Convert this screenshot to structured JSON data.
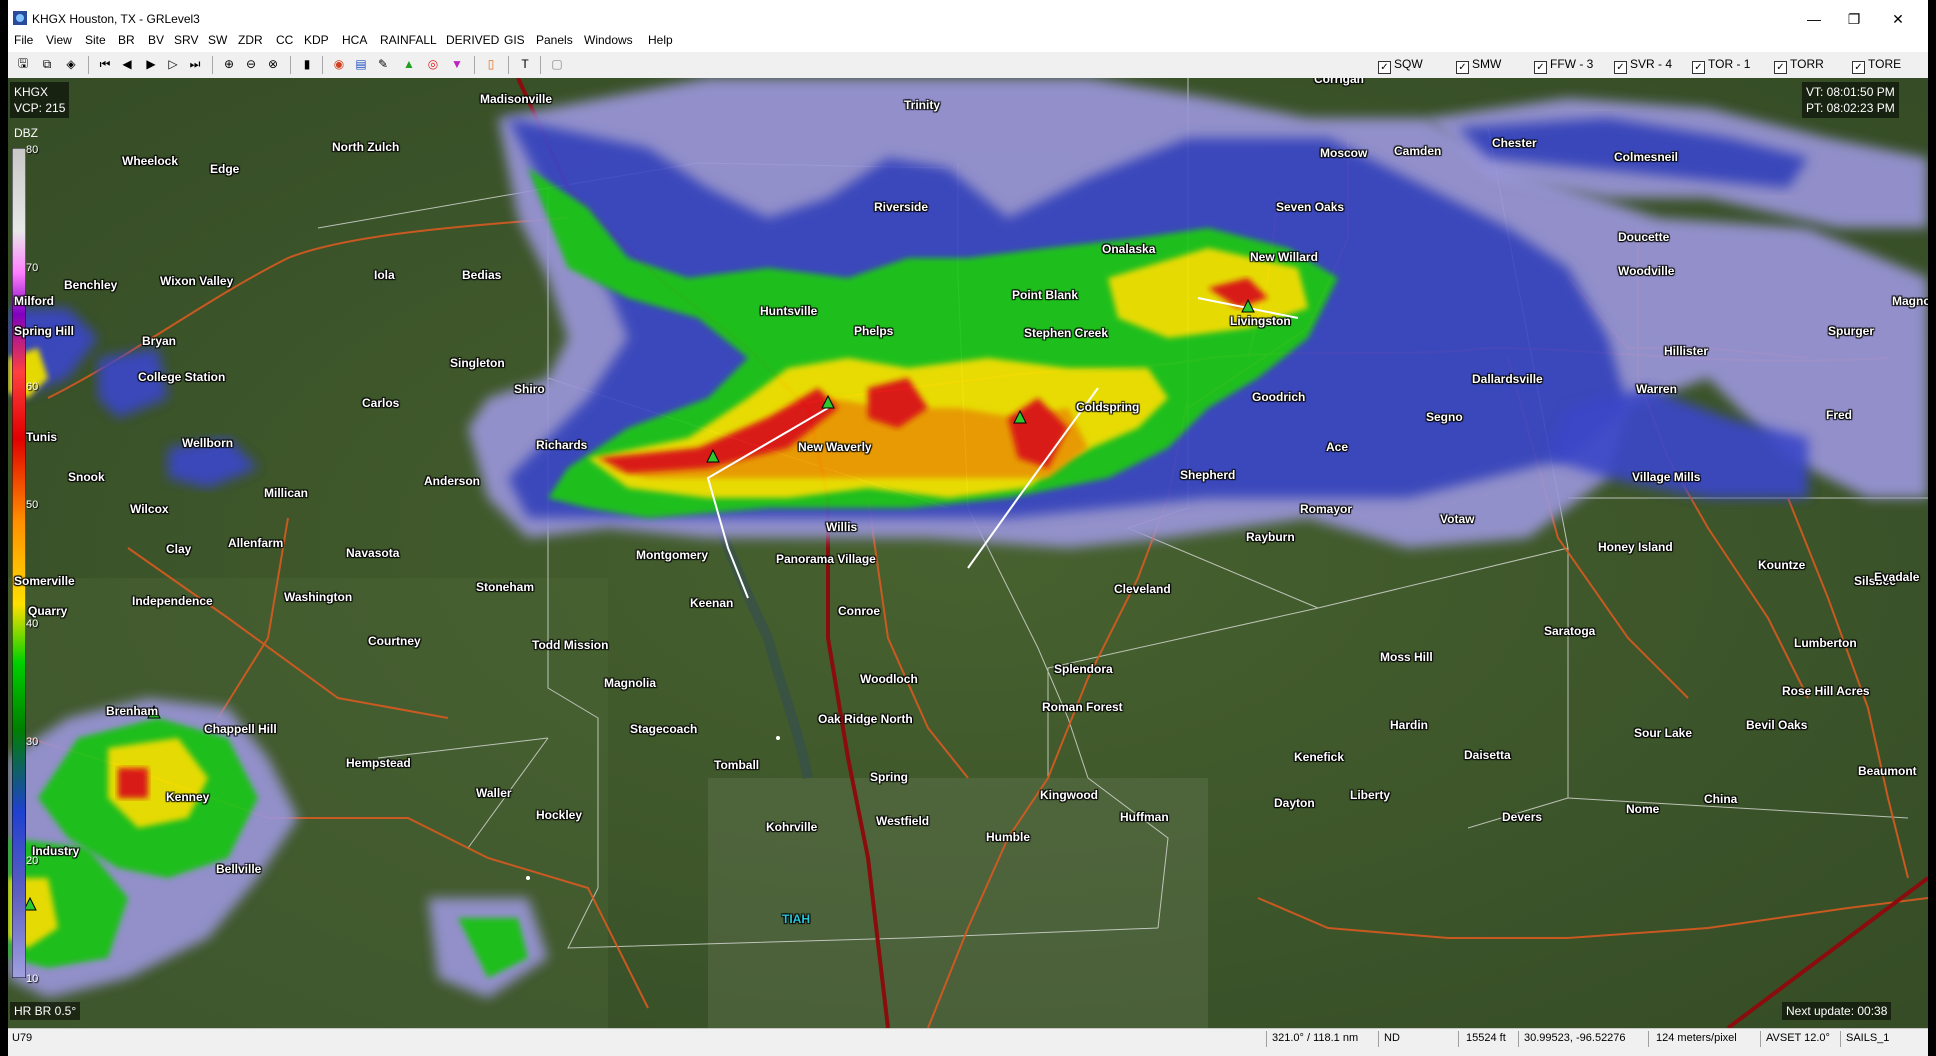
{
  "window": {
    "title": "KHGX Houston, TX - GRLevel3",
    "minimize": "—",
    "maximize": "❐",
    "close": "✕"
  },
  "menu": [
    "File",
    "View",
    "Site",
    "BR",
    "BV",
    "SRV",
    "SW",
    "ZDR",
    "CC",
    "KDP",
    "HCA",
    "RAINFALL",
    "DERIVED",
    "GIS",
    "Panels",
    "Windows",
    "Help"
  ],
  "toolbar_checks": [
    {
      "label": "SQW",
      "checked": true
    },
    {
      "label": "SMW",
      "checked": true
    },
    {
      "label": "FFW - 3",
      "checked": true
    },
    {
      "label": "SVR - 4",
      "checked": true
    },
    {
      "label": "TOR - 1",
      "checked": true
    },
    {
      "label": "TORR",
      "checked": true
    },
    {
      "label": "TORE",
      "checked": true
    }
  ],
  "overlays": {
    "site": "KHGX",
    "vcp": "VCP: 215",
    "units": "DBZ",
    "vt": "VT: 08:01:50 PM",
    "pt": "PT: 08:02:23 PM",
    "product": "HR BR 0.5°",
    "next_update": "Next update: 00:38",
    "tiah": "TIAH"
  },
  "colorbar_ticks": [
    "80",
    "70",
    "60",
    "50",
    "40",
    "30",
    "20",
    "10"
  ],
  "cities": [
    {
      "name": "Madisonville"
    },
    {
      "name": "Trinity"
    },
    {
      "name": "Corrigan"
    },
    {
      "name": "Wheelock"
    },
    {
      "name": "Edge"
    },
    {
      "name": "North Zulch"
    },
    {
      "name": "Moscow"
    },
    {
      "name": "Camden"
    },
    {
      "name": "Chester"
    },
    {
      "name": "Colmesneil"
    },
    {
      "name": "Riverside"
    },
    {
      "name": "Seven Oaks"
    },
    {
      "name": "Doucette"
    },
    {
      "name": "Onalaska"
    },
    {
      "name": "New Willard"
    },
    {
      "name": "Woodville"
    },
    {
      "name": "Benchley"
    },
    {
      "name": "Wixon Valley"
    },
    {
      "name": "Iola"
    },
    {
      "name": "Bedias"
    },
    {
      "name": "Point Blank"
    },
    {
      "name": "Huntsville"
    },
    {
      "name": "Livingston"
    },
    {
      "name": "Spurger"
    },
    {
      "name": "Bryan"
    },
    {
      "name": "Phelps"
    },
    {
      "name": "Stephen Creek"
    },
    {
      "name": "Hillister"
    },
    {
      "name": "Singleton"
    },
    {
      "name": "College Station"
    },
    {
      "name": "Dallardsville"
    },
    {
      "name": "Shiro"
    },
    {
      "name": "Carlos"
    },
    {
      "name": "Warren"
    },
    {
      "name": "Goodrich"
    },
    {
      "name": "Coldspring"
    },
    {
      "name": "Segno"
    },
    {
      "name": "Fred"
    },
    {
      "name": "Wellborn"
    },
    {
      "name": "Richards"
    },
    {
      "name": "New Waverly"
    },
    {
      "name": "Ace"
    },
    {
      "name": "Snook"
    },
    {
      "name": "Anderson"
    },
    {
      "name": "Shepherd"
    },
    {
      "name": "Village Mills"
    },
    {
      "name": "Millican"
    },
    {
      "name": "Romayor"
    },
    {
      "name": "Wilcox"
    },
    {
      "name": "Votaw"
    },
    {
      "name": "Willis"
    },
    {
      "name": "Rayburn"
    },
    {
      "name": "Allenfarm"
    },
    {
      "name": "Clay"
    },
    {
      "name": "Navasota"
    },
    {
      "name": "Honey Island"
    },
    {
      "name": "Montgomery"
    },
    {
      "name": "Panorama Village"
    },
    {
      "name": "Kountze"
    },
    {
      "name": "Silsbee"
    },
    {
      "name": "Stoneham"
    },
    {
      "name": "Cleveland"
    },
    {
      "name": "Independence"
    },
    {
      "name": "Washington"
    },
    {
      "name": "Keenan"
    },
    {
      "name": "Conroe"
    },
    {
      "name": "Quarry"
    },
    {
      "name": "Saratoga"
    },
    {
      "name": "Lumberton"
    },
    {
      "name": "Courtney"
    },
    {
      "name": "Todd Mission"
    },
    {
      "name": "Moss Hill"
    },
    {
      "name": "Splendora"
    },
    {
      "name": "Magnolia"
    },
    {
      "name": "Woodloch"
    },
    {
      "name": "Rose Hill Acres"
    },
    {
      "name": "Brenham"
    },
    {
      "name": "Roman Forest"
    },
    {
      "name": "Oak Ridge North"
    },
    {
      "name": "Chappell Hill"
    },
    {
      "name": "Hardin"
    },
    {
      "name": "Stagecoach"
    },
    {
      "name": "Bevil Oaks"
    },
    {
      "name": "Sour Lake"
    },
    {
      "name": "Daisetta"
    },
    {
      "name": "Hempstead"
    },
    {
      "name": "Tomball"
    },
    {
      "name": "Kenefick"
    },
    {
      "name": "Beaumont"
    },
    {
      "name": "Waller"
    },
    {
      "name": "Spring"
    },
    {
      "name": "Kingwood"
    },
    {
      "name": "Kenney"
    },
    {
      "name": "Dayton"
    },
    {
      "name": "Liberty"
    },
    {
      "name": "China"
    },
    {
      "name": "Hockley"
    },
    {
      "name": "Huffman"
    },
    {
      "name": "Devers"
    },
    {
      "name": "Nome"
    },
    {
      "name": "Westfield"
    },
    {
      "name": "Kohrville"
    },
    {
      "name": "Humble"
    },
    {
      "name": "Bellville"
    },
    {
      "name": "Industry"
    },
    {
      "name": "Tunis"
    },
    {
      "name": "Somerville"
    },
    {
      "name": "Evadale"
    },
    {
      "name": "Magnolia Springs"
    },
    {
      "name": "Milford"
    },
    {
      "name": "Spring Hill"
    }
  ],
  "status": {
    "road": "U79",
    "azran": "321.0° / 118.1 nm",
    "value": "ND",
    "height": "15524 ft",
    "latlon": "30.99523, -96.52276",
    "res": "124 meters/pixel",
    "avset": "AVSET 12.0°",
    "sails": "SAILS_1"
  },
  "colors": {
    "terrain": "#3f5a2c",
    "light_purple": "#9a95d8",
    "blue": "#3a46c8",
    "green": "#1ec81e",
    "yellow": "#f5e600",
    "orange": "#f5a000",
    "red": "#e61414"
  }
}
